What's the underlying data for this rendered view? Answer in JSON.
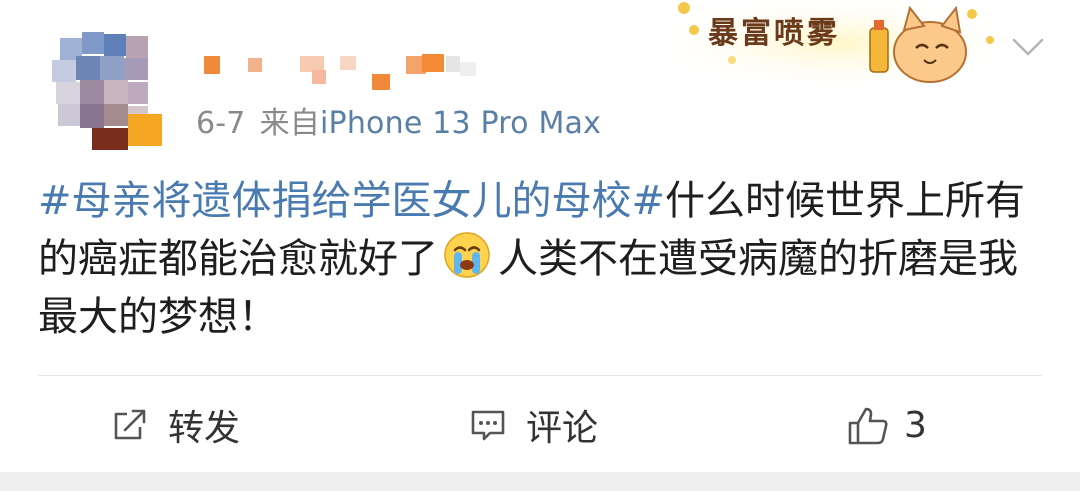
{
  "post": {
    "date": "6-7",
    "source_prefix": "来自",
    "source_device": "iPhone 13 Pro Max",
    "badge_text": "暴富喷雾",
    "content": {
      "topic": "#母亲将遗体捐给学医女儿的母校#",
      "text_before_emoji": "什么时候世界上所有的癌症都能治愈就好了",
      "emoji": "crying-face",
      "text_after_emoji": "人类不在遭受病魔的折磨是我最大的梦想！"
    }
  },
  "actions": {
    "repost_label": "转发",
    "comment_label": "评论",
    "like_count": "3"
  },
  "icons": {
    "repost": "share-icon",
    "comment": "comment-icon",
    "like": "thumbs-up-icon",
    "more": "chevron-down-icon"
  },
  "colors": {
    "topic_link": "#4a7bb0",
    "source_link": "#5a7fa6",
    "meta_gray": "#8a8a8a"
  }
}
